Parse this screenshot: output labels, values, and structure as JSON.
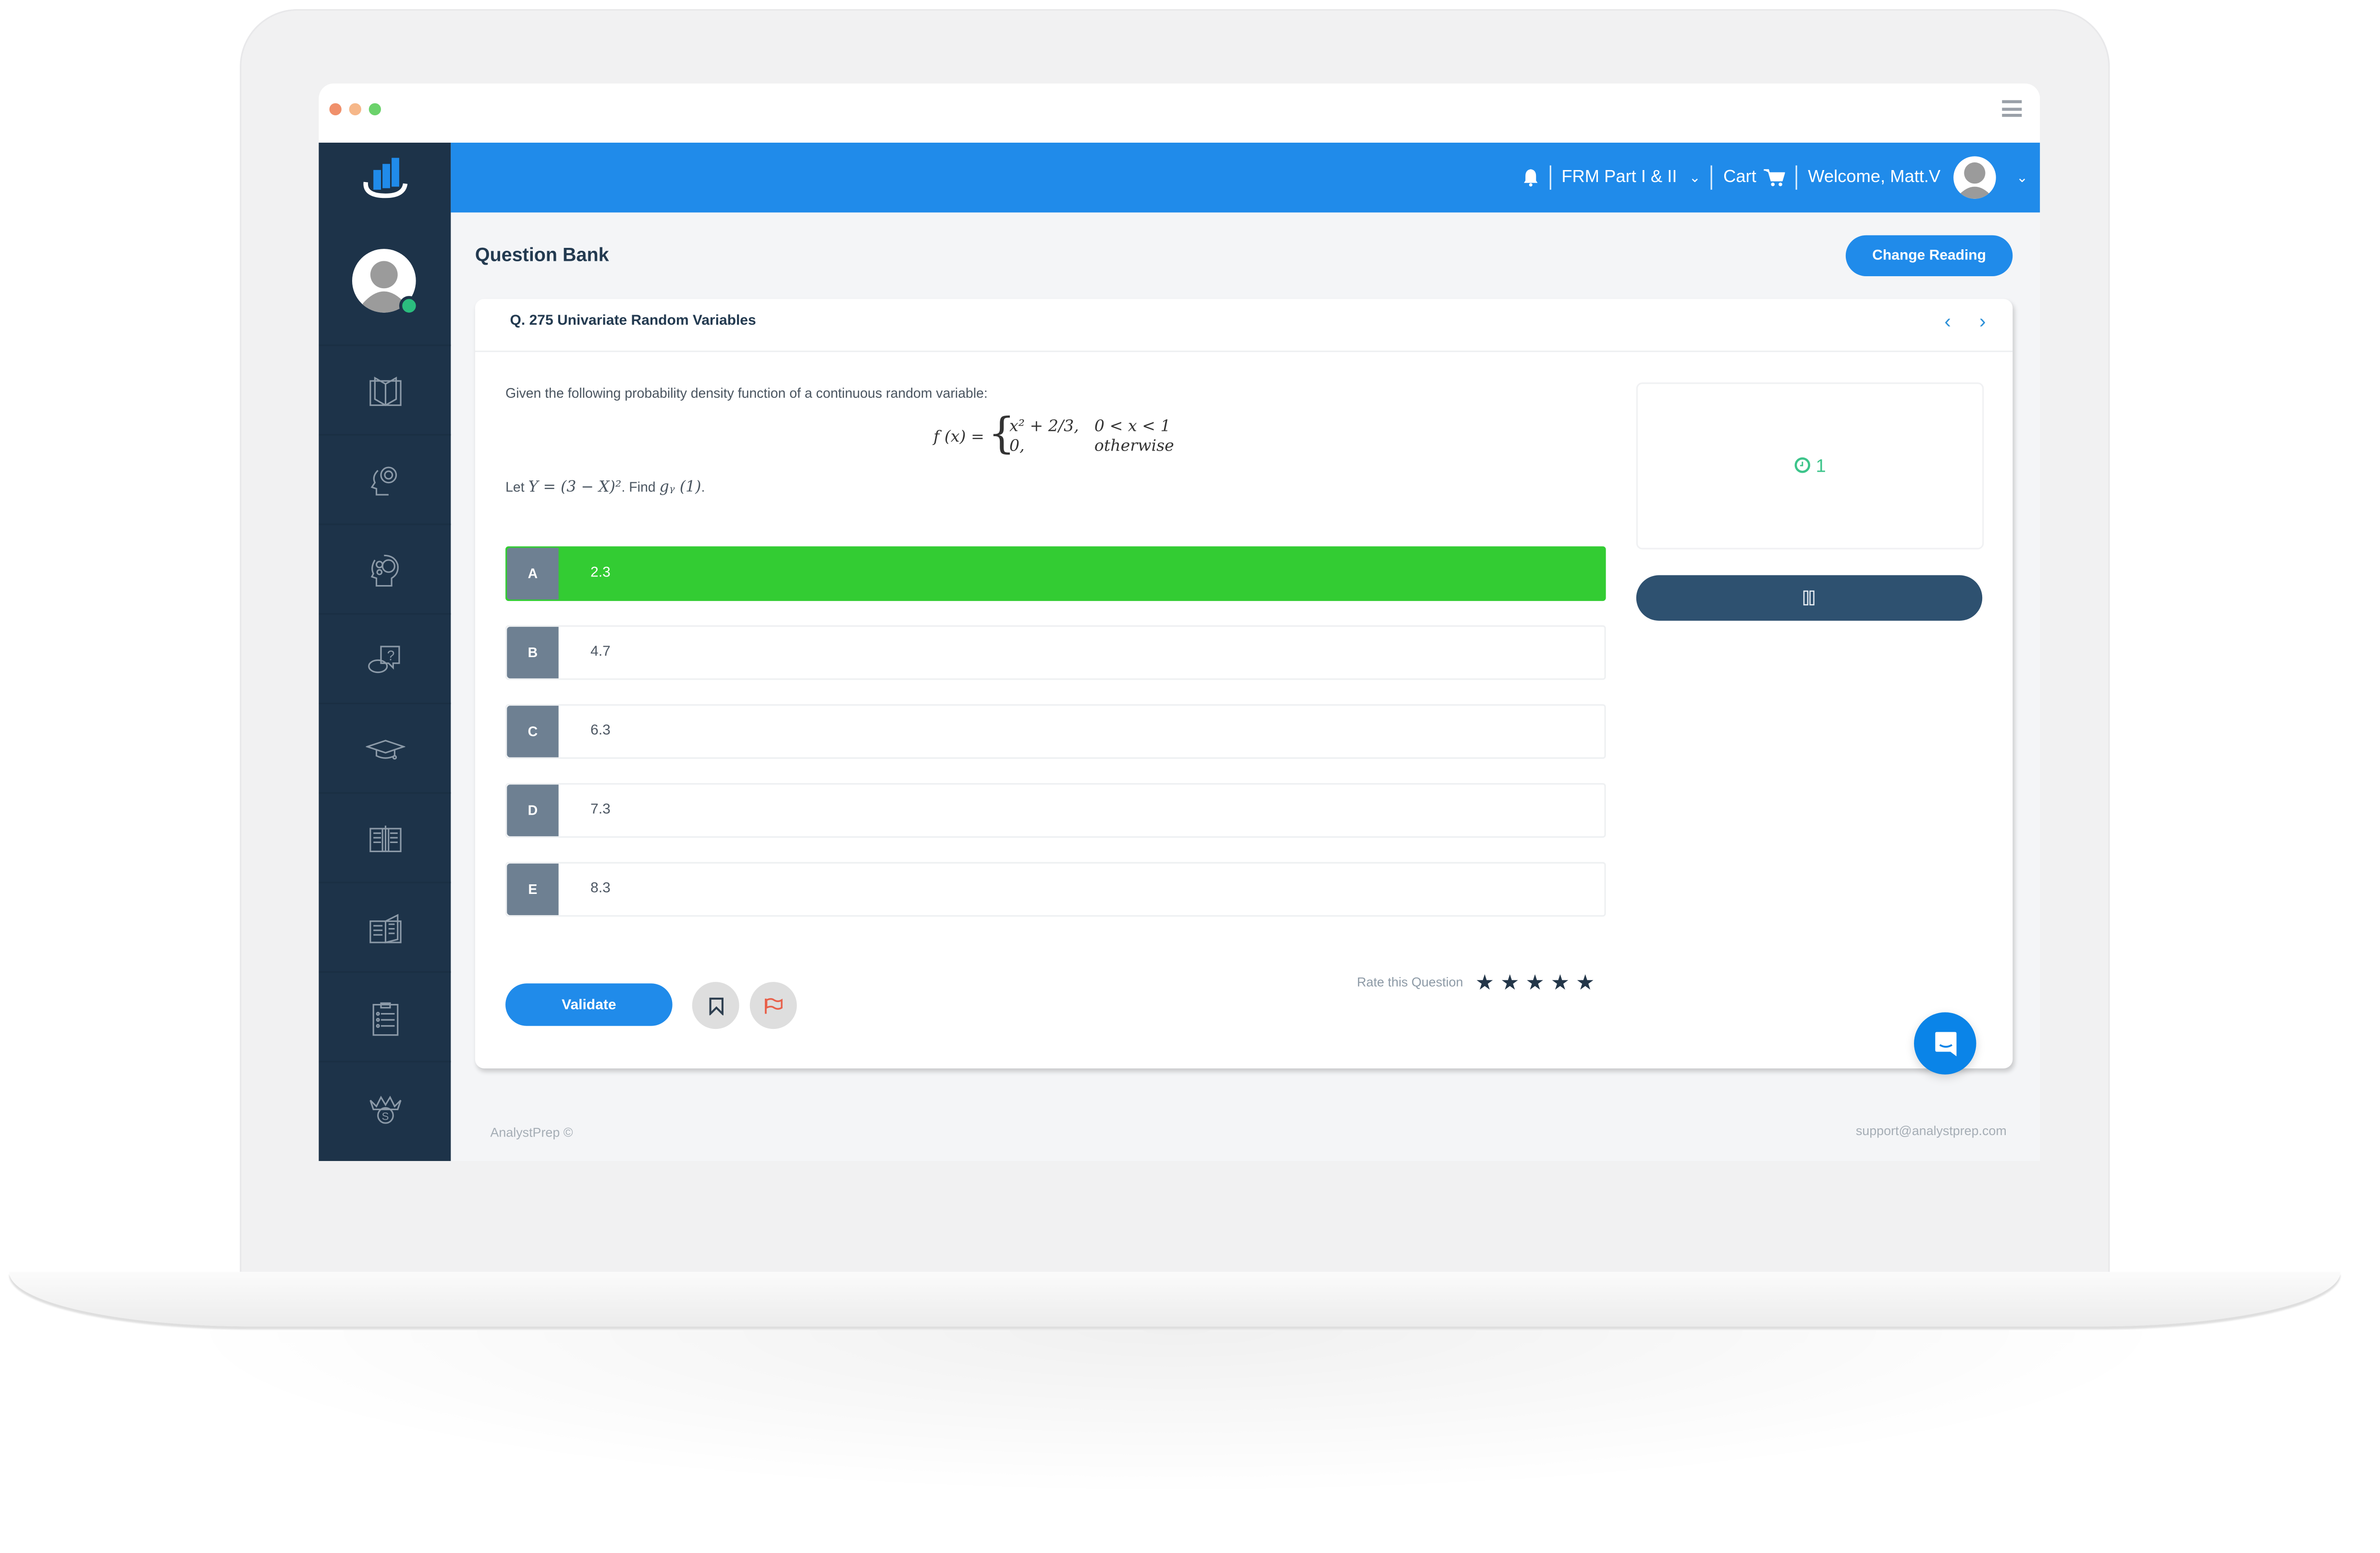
{
  "window": {
    "traffic_lights": [
      {
        "name": "close",
        "color": "#f0906b"
      },
      {
        "name": "minimize",
        "color": "#f6b789"
      },
      {
        "name": "maximize",
        "color": "#6bd26b"
      }
    ],
    "menu_icon": "hamburger-icon"
  },
  "topbar": {
    "bell_icon": "bell-icon",
    "course_label": "FRM Part I & II",
    "cart_label": "Cart",
    "welcome_label": "Welcome, Matt.V",
    "color": "#208bea"
  },
  "sidebar": {
    "logo": "analystprep-logo",
    "status": "online",
    "items": [
      {
        "icon": "book-reader-icon"
      },
      {
        "icon": "head-gear-icon"
      },
      {
        "icon": "brain-gears-icon"
      },
      {
        "icon": "question-chat-icon"
      },
      {
        "icon": "graduation-cap-icon"
      },
      {
        "icon": "open-book-pencil-icon"
      },
      {
        "icon": "open-book-icon"
      },
      {
        "icon": "clipboard-list-icon"
      },
      {
        "icon": "crown-coin-icon"
      }
    ]
  },
  "page": {
    "title": "Question Bank",
    "change_reading_label": "Change Reading"
  },
  "question": {
    "title": "Q. 275 Univariate Random Variables",
    "prev_label": "‹",
    "next_label": "›",
    "prompt": "Given the following probability density function of a continuous random variable:",
    "formula": {
      "lhs": "f (x) =",
      "case1_expr": "x² + 2/3,",
      "case1_cond": "0 < x < 1",
      "case2_expr": "0,",
      "case2_cond": "otherwise"
    },
    "task_prefix": "Let",
    "task_math1": "Y = (3 − X)²",
    "task_mid": ". Find",
    "task_math2": "gᵧ (1)",
    "task_suffix": "."
  },
  "options": [
    {
      "letter": "A",
      "value": "2.3",
      "selected": true
    },
    {
      "letter": "B",
      "value": "4.7",
      "selected": false
    },
    {
      "letter": "C",
      "value": "6.3",
      "selected": false
    },
    {
      "letter": "D",
      "value": "7.3",
      "selected": false
    },
    {
      "letter": "E",
      "value": "8.3",
      "selected": false
    }
  ],
  "timer": {
    "value": "1",
    "color": "#3cc48a",
    "pause_icon": "pause-icon"
  },
  "actions": {
    "validate_label": "Validate",
    "bookmark_icon": "bookmark-icon",
    "flag_icon": "flag-icon",
    "rate_label": "Rate this Question",
    "stars_total": 5,
    "star_glyph": "★"
  },
  "footer": {
    "copyright": "AnalystPrep ©",
    "support_email": "support@analystprep.com"
  },
  "chat_widget": {
    "icon": "chat-bubble-icon"
  }
}
